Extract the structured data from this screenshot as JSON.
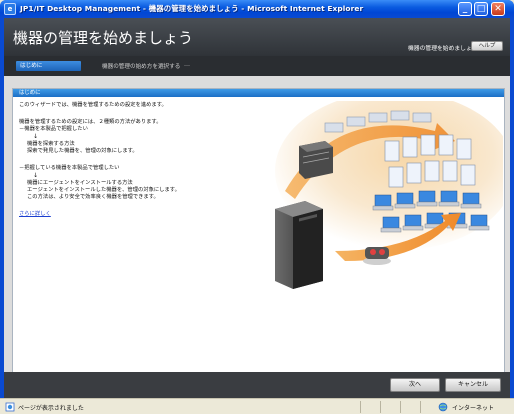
{
  "window": {
    "title": "JP1/IT Desktop Management - 機器の管理を始めましょう - Microsoft Internet Explorer",
    "icon_label": "e",
    "minimize": "_",
    "maximize": "□",
    "close": "✕"
  },
  "header": {
    "title": "機器の管理を始めましょう",
    "subtitle": "機器の管理を始めましょう",
    "help_label": "ヘルプ"
  },
  "steps": [
    {
      "label": "はじめに",
      "active": true
    },
    {
      "label": "機器の管理の始め方を選択する",
      "active": false
    },
    {
      "label": "…",
      "active": false
    }
  ],
  "panel": {
    "heading": "はじめに",
    "intro": "このウィザードでは、機器を管理するための設定を進めます。",
    "method_intro": "機器を管理するための設定には、２種類の方法があります。",
    "option1_title": "－機器を本製品で把握したい",
    "arrow": "↓",
    "option1_method": "機器を探索する方法",
    "option1_desc": "探索で発見した機器を、管理の対象にします。",
    "option2_title": "－把握している機器を本製品で管理したい",
    "option2_method": "機器にエージェントをインストールする方法",
    "option2_desc1": "エージェントをインストールした機器を、管理の対象にします。",
    "option2_desc2": "この方法は、より安全で効率良く機器を管理できます。",
    "more_link": "さらに詳しく"
  },
  "footer": {
    "next_label": "次へ",
    "cancel_label": "キャンセル"
  },
  "status": {
    "text": "ページが表示されました",
    "zone": "インターネット"
  },
  "colors": {
    "accent_blue": "#1c6fc6",
    "header_dark": "#2f3338",
    "arrow_orange": "#f39a3c"
  }
}
